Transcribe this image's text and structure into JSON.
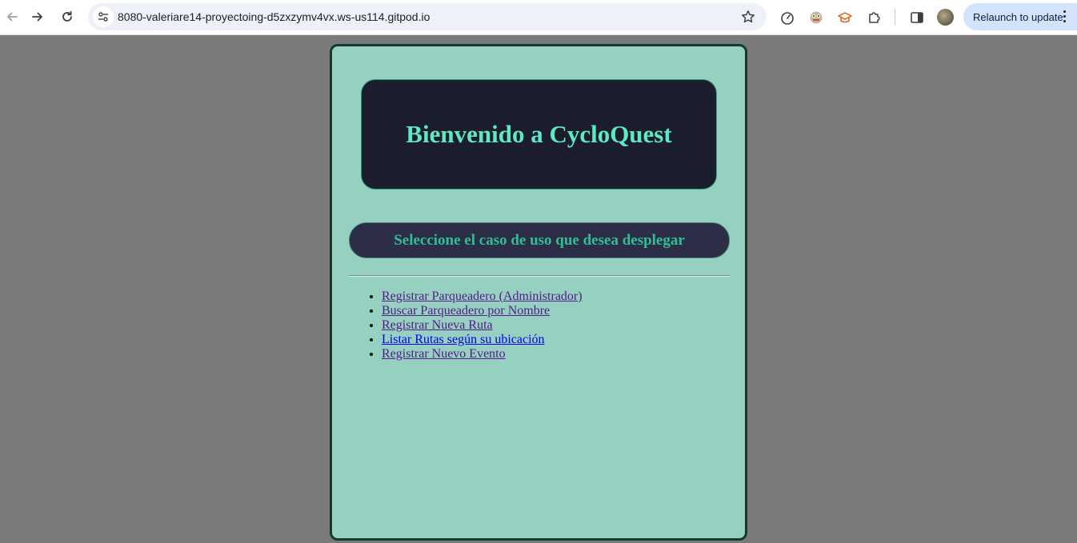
{
  "browser": {
    "url": "8080-valeriare14-proyectoing-d5zxzymv4vx.ws-us114.gitpod.io",
    "relaunch_label": "Relaunch to update",
    "icons": [
      "back-icon",
      "forward-icon",
      "reload-icon",
      "site-info-icon",
      "bookmark-star-icon",
      "performance-icon",
      "extension-frog-icon",
      "extension-hat-icon",
      "extensions-puzzle-icon",
      "side-panel-icon",
      "profile-avatar",
      "menu-kebab-icon"
    ]
  },
  "page": {
    "title": "Bienvenido a CycloQuest",
    "subtitle": "Seleccione el caso de uso que desea desplegar",
    "links": [
      {
        "label": "Registrar Parqueadero (Administrador)",
        "visited": true
      },
      {
        "label": "Buscar Parqueadero por Nombre",
        "visited": true
      },
      {
        "label": "Registrar Nueva Ruta",
        "visited": true
      },
      {
        "label": "Listar Rutas según su ubicación",
        "visited": false
      },
      {
        "label": "Registrar Nuevo Evento",
        "visited": true
      }
    ]
  },
  "colors": {
    "page_background": "#7a7a7a",
    "card_background": "#95d0c0",
    "card_border": "#133a33",
    "hero_background": "#1b1d2c",
    "hero_text": "#5fe8c5",
    "subbar_background": "#2c2d46",
    "subbar_text": "#2fbf92",
    "link_visited": "#551a8b",
    "link_unvisited": "#0000ee"
  }
}
